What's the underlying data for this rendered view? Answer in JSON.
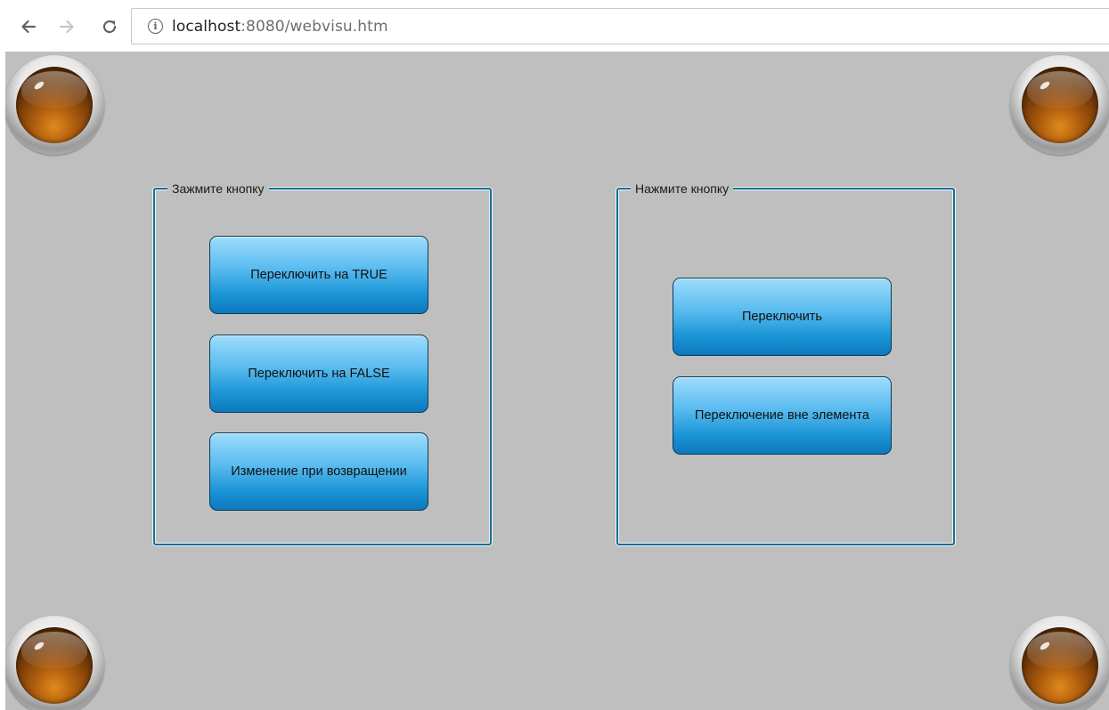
{
  "browser": {
    "url_host": "localhost",
    "url_rest": ":8080/webvisu.htm",
    "back_icon": "arrow-left-icon",
    "forward_icon": "arrow-right-icon",
    "reload_icon": "reload-icon",
    "info_icon": "info-icon"
  },
  "visu": {
    "background": "#bfbfbf",
    "lamp_color": "#b05e0e",
    "button_color": "#1b95d6",
    "frame_color": "#1b6e96",
    "left_group": {
      "title": "Зажмите кнопку",
      "buttons": [
        "Переключить на TRUE",
        "Переключить на FALSE",
        "Изменение при возвращении"
      ]
    },
    "right_group": {
      "title": "Нажмите кнопку",
      "buttons": [
        "Переключить",
        "Переключение вне элемента"
      ]
    }
  }
}
